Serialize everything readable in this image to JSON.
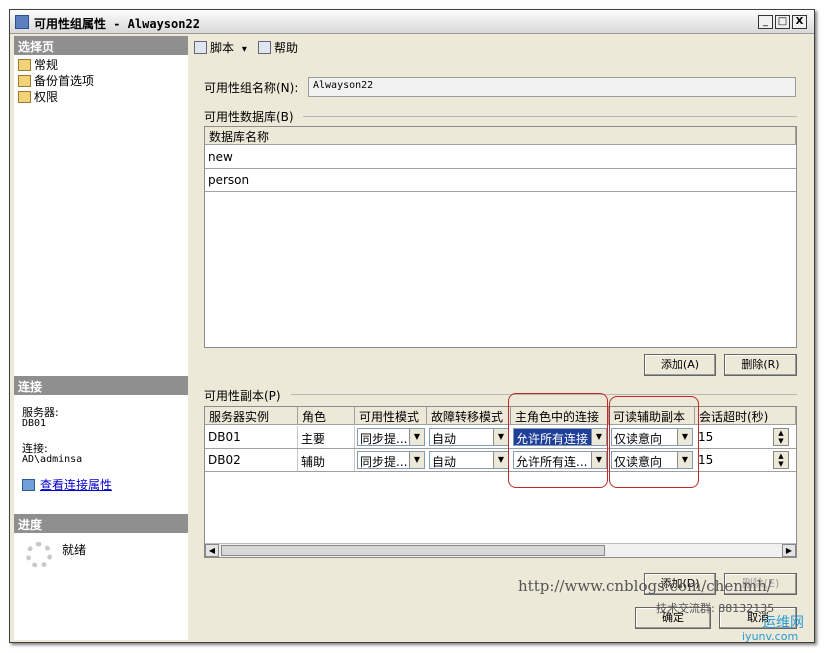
{
  "window": {
    "title": "可用性组属性 - Alwayson22",
    "min": "_",
    "max": "□",
    "close": "X"
  },
  "left": {
    "select_page_header": "选择页",
    "pages": [
      "常规",
      "备份首选项",
      "权限"
    ],
    "connection_header": "连接",
    "server_label": "服务器:",
    "server_value": "DB01",
    "conn_label": "连接:",
    "conn_value": "AD\\adminsa",
    "view_conn_link": "查看连接属性",
    "progress_header": "进度",
    "progress_status": "就绪"
  },
  "toolbar": {
    "script": "脚本",
    "script_arrow": "▾",
    "help": "帮助"
  },
  "ag": {
    "name_label": "可用性组名称(N):",
    "name_value": "Alwayson22",
    "db_group_label": "可用性数据库(B)",
    "db_col_header": "数据库名称",
    "databases": [
      "new",
      "person"
    ],
    "add_db": "添加(A)",
    "remove_db": "删除(R)",
    "replica_group_label": "可用性副本(P)",
    "replica_headers": [
      "服务器实例",
      "角色",
      "可用性模式",
      "故障转移模式",
      "主角色中的连接",
      "可读辅助副本",
      "会话超时(秒)"
    ],
    "replicas": [
      {
        "server": "DB01",
        "role": "主要",
        "mode": "同步提...",
        "failover": "自动",
        "primary_conn": "允许所有连接",
        "readable": "仅读意向",
        "timeout": "15"
      },
      {
        "server": "DB02",
        "role": "辅助",
        "mode": "同步提...",
        "failover": "自动",
        "primary_conn": "允许所有连...",
        "readable": "仅读意向",
        "timeout": "15"
      }
    ],
    "add_replica": "添加(D)",
    "remove_replica": "删除(E)"
  },
  "footer": {
    "ok": "确定",
    "cancel": "取消"
  },
  "watermarks": {
    "url": "http://www.cnblogs.com/chenmh/",
    "group": "技术交流群: 88132135",
    "site": "运维网",
    "site_url": "iyunv.com"
  }
}
